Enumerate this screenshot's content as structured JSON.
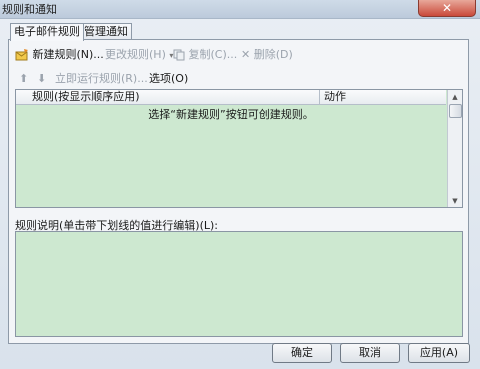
{
  "window": {
    "title": "规则和通知",
    "close_icon": "close-icon"
  },
  "tabs": [
    {
      "label": "电子邮件规则",
      "active": true
    },
    {
      "label": "管理通知",
      "active": false
    }
  ],
  "toolbar1": {
    "new_rule": "新建规则(N)...",
    "edit_rule": "更改规则(H)",
    "copy": "复制(C)...",
    "delete": "删除(D)"
  },
  "toolbar2": {
    "run_rules": "立即运行规则(R)...",
    "options": "选项(O)"
  },
  "rules_list": {
    "col_rule": "规则(按显示顺序应用)",
    "col_action": "动作",
    "empty_hint": "选择“新建规则”按钮可创建规则。"
  },
  "description": {
    "label": "规则说明(单击带下划线的值进行编辑)(L):"
  },
  "buttons": {
    "ok": "确定",
    "cancel": "取消",
    "apply": "应用(A)"
  },
  "colors": {
    "list_bg": "#cde8d0",
    "window_bg": "#dfe6ee",
    "disabled_text": "#9ba3ad"
  }
}
